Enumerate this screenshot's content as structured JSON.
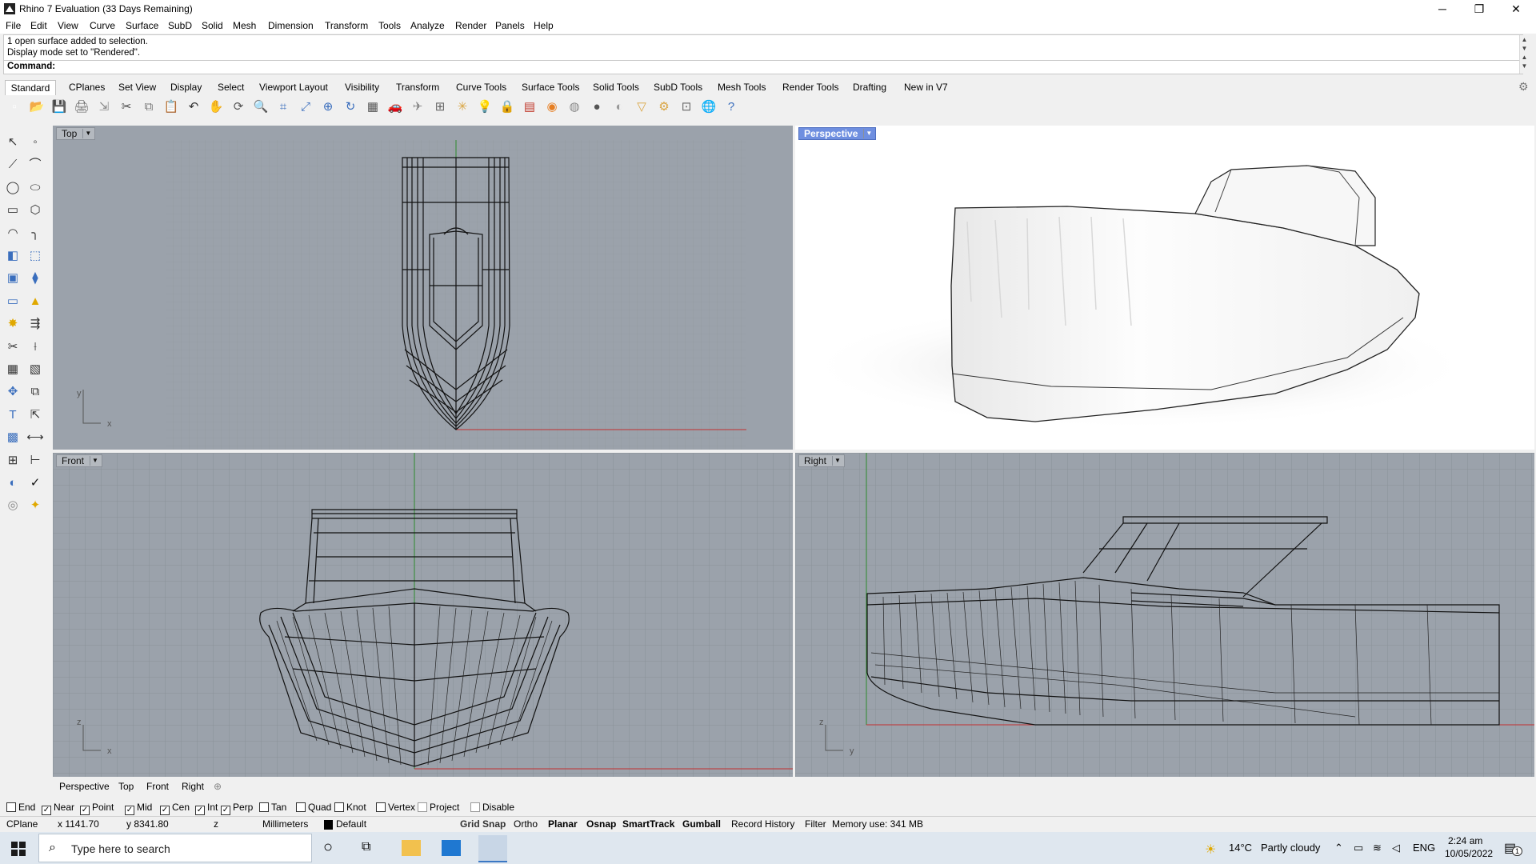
{
  "window": {
    "title": "Rhino 7 Evaluation (33 Days Remaining)",
    "minimize": "─",
    "maximize": "❐",
    "close": "✕"
  },
  "menu": [
    "File",
    "Edit",
    "View",
    "Curve",
    "Surface",
    "SubD",
    "Solid",
    "Mesh",
    "Dimension",
    "Transform",
    "Tools",
    "Analyze",
    "Render",
    "Panels",
    "Help"
  ],
  "command": {
    "history": [
      "1 open surface added to selection.",
      "Display mode set to \"Rendered\"."
    ],
    "label": "Command:",
    "value": ""
  },
  "toolbar_tabs": [
    "Standard",
    "CPlanes",
    "Set View",
    "Display",
    "Select",
    "Viewport Layout",
    "Visibility",
    "Transform",
    "Curve Tools",
    "Surface Tools",
    "Solid Tools",
    "SubD Tools",
    "Mesh Tools",
    "Render Tools",
    "Drafting",
    "New in V7"
  ],
  "toolbar_icons": [
    "new-icon",
    "open-icon",
    "save-icon",
    "print-icon",
    "import-icon",
    "cut-icon",
    "copy-icon",
    "paste-icon",
    "undo-icon",
    "pan-icon",
    "rotate-view-icon",
    "zoom-icon",
    "zoom-window-icon",
    "zoom-extents-icon",
    "zoom-selected-icon",
    "rotate-icon",
    "grid-icon",
    "car-icon",
    "plane-icon",
    "cplane-icon",
    "snap-icon",
    "light-icon",
    "lock-icon",
    "layer-icon",
    "color-wheel-icon",
    "material-icon",
    "sphere-icon",
    "render-sphere-icon",
    "filter-icon",
    "settings-gear-icon",
    "mesh-icon",
    "globe-icon",
    "help-icon"
  ],
  "sidebar_icons": [
    "select-arrow-icon",
    "point-icon",
    "polyline-icon",
    "curve-icon",
    "circle-icon",
    "ellipse-icon",
    "rectangle-icon",
    "polygon-icon",
    "arc-icon",
    "fillet-icon",
    "surface-corner-icon",
    "loft-icon",
    "box-icon",
    "boolean-icon",
    "cylinder-icon",
    "extrude-icon",
    "explode-icon",
    "join-icon",
    "trim-icon",
    "split-icon",
    "group-icon",
    "ungroup-icon",
    "move-icon",
    "copy-transform-icon",
    "text-icon",
    "scale-icon",
    "array-icon",
    "mirror-icon",
    "grid-array-icon",
    "dimension-icon",
    "analyze-icon",
    "check-icon",
    "render-icon",
    "light-tool-icon"
  ],
  "viewports": {
    "top": "Top",
    "perspective": "Perspective",
    "front": "Front",
    "right": "Right"
  },
  "axes": {
    "top": [
      "y",
      "x"
    ],
    "front": [
      "z",
      "x"
    ],
    "right": [
      "z",
      "y"
    ]
  },
  "viewport_tabs": [
    "Perspective",
    "Top",
    "Front",
    "Right"
  ],
  "osnap": [
    {
      "label": "End",
      "checked": false
    },
    {
      "label": "Near",
      "checked": true
    },
    {
      "label": "Point",
      "checked": true
    },
    {
      "label": "Mid",
      "checked": true
    },
    {
      "label": "Cen",
      "checked": true
    },
    {
      "label": "Int",
      "checked": true
    },
    {
      "label": "Perp",
      "checked": true
    },
    {
      "label": "Tan",
      "checked": false
    },
    {
      "label": "Quad",
      "checked": false
    },
    {
      "label": "Knot",
      "checked": false
    },
    {
      "label": "Vertex",
      "checked": false
    },
    {
      "label": "Project",
      "checked": false
    },
    {
      "label": "Disable",
      "checked": false
    }
  ],
  "status": {
    "cplane": "CPlane",
    "x": "x 1141.70",
    "y": "y 8341.80",
    "z": "z",
    "units": "Millimeters",
    "layer": "Default",
    "grid_snap": "Grid Snap",
    "ortho": "Ortho",
    "planar": "Planar",
    "osnap": "Osnap",
    "smarttrack": "SmartTrack",
    "gumball": "Gumball",
    "record_history": "Record History",
    "filter": "Filter",
    "memory": "Memory use: 341 MB"
  },
  "taskbar": {
    "search_placeholder": "Type here to search",
    "weather_temp": "14°C",
    "weather_text": "Partly cloudy",
    "lang": "ENG",
    "time": "2:24 am",
    "date": "10/05/2022",
    "notif_count": "1"
  }
}
